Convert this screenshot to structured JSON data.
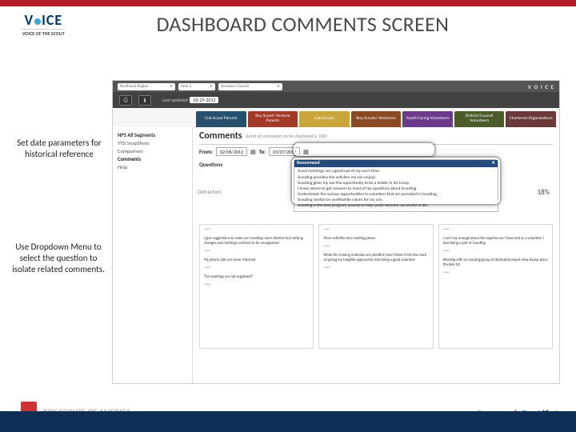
{
  "header": {
    "title": "DASHBOARD  COMMENTS SCREEN"
  },
  "logo": {
    "brand_part1": "V",
    "brand_part2": "CE",
    "brand_mid": "I",
    "tagline": "VOICE OF THE SCOUT"
  },
  "callouts": {
    "a": "Set date parameters for historical reference",
    "b": "Use Dropdown Menu to select the question to isolate related comments."
  },
  "screenshot": {
    "topbar": {
      "dd1": "Northeast Region",
      "dd2": "Area 1",
      "dd3": "Annawon Council",
      "vlogo": "V O I C E"
    },
    "row2": {
      "last_updated_label": "Last updated:",
      "last_updated": "02-29-2012"
    },
    "tabs": [
      {
        "label": "Cub Scout Parents",
        "cls": "t1"
      },
      {
        "label": "Boy Scout/ Venture Parents",
        "cls": "t2"
      },
      {
        "label": "Cub Scouts",
        "cls": "t3"
      },
      {
        "label": "Boy Scouts/ Venturers",
        "cls": "t4"
      },
      {
        "label": "Youth-Facing Volunteers",
        "cls": "t5"
      },
      {
        "label": "District/Council Volunteers",
        "cls": "t6"
      },
      {
        "label": "Chartered Organizations",
        "cls": "t7"
      }
    ],
    "side": {
      "group": "NPS All Segments",
      "items": [
        "YTD SnapShots",
        "Comparison",
        "Comments",
        "Help"
      ],
      "active": "Comments"
    },
    "crumb": {
      "main": "Comments",
      "sub": "(Limit of comments to be displayed is 100)"
    },
    "filters": {
      "from_label": "From:",
      "from": "02/06/2012",
      "to_label": "To:",
      "to": "03/07/2012"
    },
    "qlabel": "Questions",
    "detractors": "Detractors",
    "pct": "18%",
    "recommend": {
      "header": "Recommend",
      "lines": [
        "Scout meetings are a good use of my son's time.",
        "Scouting provides the activites my son enjoys.",
        "Scouting gives my son the opportunity to be a leader in his troop.",
        "I know where to get answers to most of my questions about Scouting.",
        "Understands the various opportunities to volunteer that are provided in Scouting.",
        "Scouting reinforces worthwhile values for my son.",
        "Scouting is the best program around to help youth become successful in life."
      ]
    },
    "cards": [
      [
        "*****",
        "I give suggestions to make our meetings more efective but nothing changes and meetings continue to be unorganized",
        "*****",
        "My phone calls are never returned",
        "*****",
        "The meetings are not organized!\"",
        "*****"
      ],
      [
        "*****",
        "More activities less meeting please",
        "*****",
        "While the training materials are plentiful I don't think it hits the mark on giving me tangible approaches into being a good volunteer",
        "*****"
      ],
      [
        "*****",
        "I can't say enough about the experiences I have had as a volunteer. I love being a part of Scouting",
        "*****",
        "Working with an amazing group of dedicated people who always place the kids 1st",
        "*****"
      ]
    ]
  },
  "footer": {
    "org": "BOY SCOUTS OF AMERICA",
    "prep1": "Prepared.",
    "prep2": " For Life.",
    "tm": "®"
  }
}
